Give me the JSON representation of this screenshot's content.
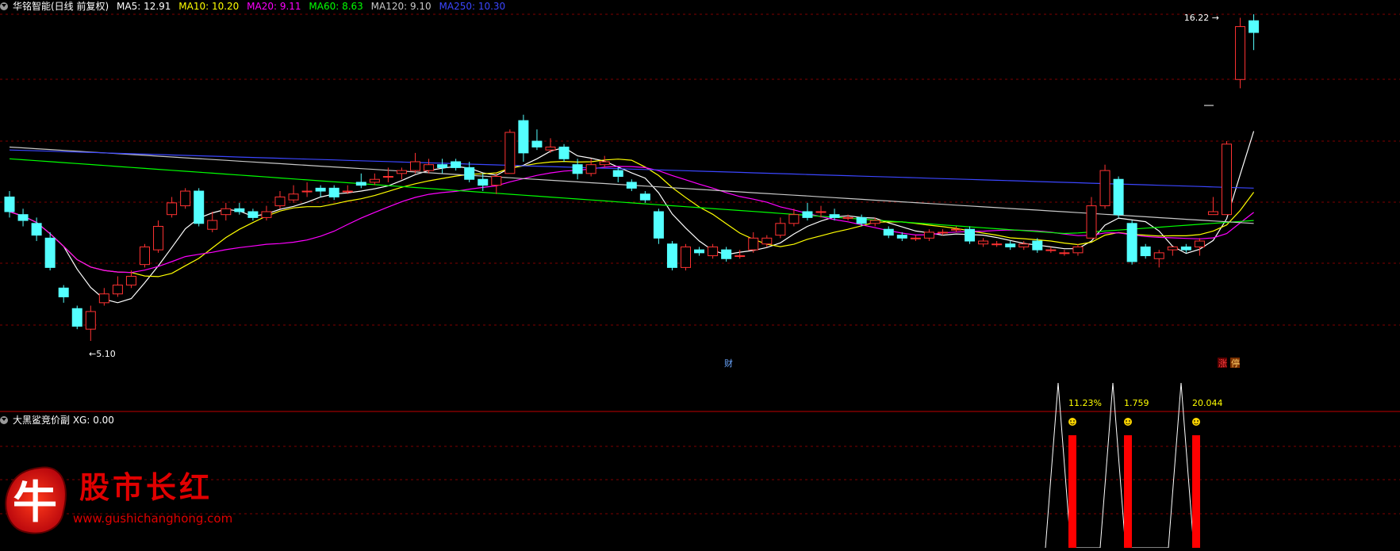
{
  "header": {
    "stock_title": "华铭智能(日线 前复权)",
    "ma": [
      {
        "label": "MA5: 12.91",
        "color": "#ffffff"
      },
      {
        "label": "MA10: 10.20",
        "color": "#ffff00"
      },
      {
        "label": "MA20: 9.11",
        "color": "#ff00ff"
      },
      {
        "label": "MA60: 8.63",
        "color": "#00ff00"
      },
      {
        "label": "MA120: 9.10",
        "color": "#c8c8c8"
      },
      {
        "label": "MA250: 10.30",
        "color": "#3b46ff"
      }
    ]
  },
  "price_panel": {
    "high_label": "16.22",
    "low_label": "5.10",
    "markers": {
      "cai": "财",
      "zhang": "涨",
      "ting": "停"
    }
  },
  "indicator_panel": {
    "title": "大黑鲨竞价副 XG: 0.00",
    "signals": [
      {
        "label": "11.23%",
        "percent_sign": "%"
      },
      {
        "label": "1.759",
        "percent_sign": "%"
      },
      {
        "label": "20.044",
        "percent_sign": "%"
      }
    ]
  },
  "watermark": {
    "char": "牛",
    "name": "股市长红",
    "url": "www.gushichanghong.com"
  },
  "colors": {
    "up": "#ff3232",
    "down": "#54ffff",
    "ma5": "#ffffff",
    "ma10": "#ffff00",
    "ma20": "#ff00ff",
    "ma60": "#00ff00",
    "ma120": "#c8c8c8",
    "ma250": "#3b46ff",
    "grid": "#800000"
  },
  "chart_data": {
    "type": "candlestick",
    "title": "华铭智能(日线 前复权)",
    "price_range": [
      5.1,
      16.22
    ],
    "annotations": {
      "max": 16.22,
      "min": 5.1
    },
    "candles": [
      [
        10.0,
        9.5,
        10.2,
        9.3
      ],
      [
        9.4,
        9.2,
        9.6,
        9.0
      ],
      [
        9.1,
        8.7,
        9.3,
        8.5
      ],
      [
        8.6,
        7.6,
        8.8,
        7.5
      ],
      [
        6.9,
        6.6,
        7.0,
        6.4
      ],
      [
        6.2,
        5.6,
        6.3,
        5.5
      ],
      [
        5.5,
        6.1,
        6.3,
        5.1
      ],
      [
        6.4,
        6.7,
        6.9,
        6.3
      ],
      [
        6.7,
        7.0,
        7.3,
        6.6
      ],
      [
        7.0,
        7.3,
        7.5,
        6.9
      ],
      [
        7.7,
        8.3,
        8.4,
        7.6
      ],
      [
        8.2,
        9.0,
        9.2,
        8.1
      ],
      [
        9.4,
        9.8,
        10.0,
        9.3
      ],
      [
        9.7,
        10.2,
        10.3,
        9.6
      ],
      [
        10.2,
        9.1,
        10.3,
        9.0
      ],
      [
        8.9,
        9.2,
        9.5,
        8.8
      ],
      [
        9.4,
        9.6,
        9.8,
        9.2
      ],
      [
        9.6,
        9.5,
        9.8,
        9.4
      ],
      [
        9.5,
        9.3,
        9.6,
        9.2
      ],
      [
        9.3,
        9.5,
        9.7,
        9.2
      ],
      [
        9.7,
        10.0,
        10.2,
        9.6
      ],
      [
        9.9,
        10.1,
        10.4,
        9.8
      ],
      [
        10.2,
        10.2,
        10.5,
        10.0
      ],
      [
        10.3,
        10.2,
        10.4,
        10.0
      ],
      [
        10.3,
        10.0,
        10.4,
        9.9
      ],
      [
        10.2,
        10.2,
        10.4,
        10.1
      ],
      [
        10.5,
        10.4,
        10.8,
        10.3
      ],
      [
        10.5,
        10.6,
        10.8,
        10.4
      ],
      [
        10.7,
        10.7,
        11.0,
        10.5
      ],
      [
        10.8,
        10.9,
        11.0,
        10.6
      ],
      [
        10.9,
        11.2,
        11.5,
        10.8
      ],
      [
        10.9,
        11.1,
        11.3,
        10.8
      ],
      [
        11.1,
        11.0,
        11.3,
        10.8
      ],
      [
        11.2,
        11.0,
        11.3,
        10.9
      ],
      [
        11.0,
        10.6,
        11.2,
        10.5
      ],
      [
        10.6,
        10.4,
        10.8,
        10.2
      ],
      [
        10.4,
        10.7,
        10.8,
        10.1
      ],
      [
        10.8,
        12.2,
        12.3,
        10.8
      ],
      [
        12.6,
        11.5,
        12.8,
        11.2
      ],
      [
        11.9,
        11.7,
        12.3,
        11.6
      ],
      [
        11.6,
        11.7,
        12.0,
        11.5
      ],
      [
        11.7,
        11.3,
        11.8,
        11.2
      ],
      [
        11.1,
        10.8,
        11.3,
        10.6
      ],
      [
        10.8,
        11.1,
        11.3,
        10.7
      ],
      [
        11.1,
        11.2,
        11.4,
        11.0
      ],
      [
        10.9,
        10.7,
        11.0,
        10.5
      ],
      [
        10.5,
        10.3,
        10.6,
        10.2
      ],
      [
        10.1,
        9.9,
        10.2,
        9.8
      ],
      [
        9.5,
        8.6,
        9.6,
        8.4
      ],
      [
        8.4,
        7.6,
        8.5,
        7.5
      ],
      [
        7.6,
        8.3,
        8.4,
        7.5
      ],
      [
        8.2,
        8.1,
        8.3,
        8.0
      ],
      [
        8.0,
        8.3,
        8.4,
        7.9
      ],
      [
        8.2,
        7.9,
        8.3,
        7.8
      ],
      [
        8.0,
        8.0,
        8.2,
        7.9
      ],
      [
        8.2,
        8.6,
        8.8,
        8.1
      ],
      [
        8.4,
        8.6,
        8.7,
        8.3
      ],
      [
        8.7,
        9.1,
        9.3,
        8.6
      ],
      [
        9.1,
        9.4,
        9.6,
        9.0
      ],
      [
        9.5,
        9.3,
        9.8,
        9.2
      ],
      [
        9.5,
        9.5,
        9.7,
        9.3
      ],
      [
        9.4,
        9.3,
        9.6,
        9.2
      ],
      [
        9.3,
        9.3,
        9.4,
        9.2
      ],
      [
        9.3,
        9.1,
        9.4,
        9.0
      ],
      [
        9.1,
        9.2,
        9.3,
        9.0
      ],
      [
        8.9,
        8.7,
        9.0,
        8.6
      ],
      [
        8.7,
        8.6,
        8.8,
        8.5
      ],
      [
        8.6,
        8.6,
        8.7,
        8.5
      ],
      [
        8.6,
        8.8,
        8.9,
        8.5
      ],
      [
        8.8,
        8.8,
        8.9,
        8.7
      ],
      [
        8.9,
        8.9,
        9.0,
        8.8
      ],
      [
        8.9,
        8.5,
        9.0,
        8.4
      ],
      [
        8.4,
        8.5,
        8.6,
        8.3
      ],
      [
        8.4,
        8.4,
        8.5,
        8.3
      ],
      [
        8.4,
        8.3,
        8.5,
        8.2
      ],
      [
        8.3,
        8.4,
        8.5,
        8.2
      ],
      [
        8.5,
        8.2,
        8.6,
        8.1
      ],
      [
        8.2,
        8.2,
        8.3,
        8.1
      ],
      [
        8.1,
        8.1,
        8.2,
        8.0
      ],
      [
        8.1,
        8.3,
        8.4,
        8.0
      ],
      [
        8.6,
        9.7,
        10.0,
        8.6
      ],
      [
        9.7,
        10.9,
        11.1,
        9.6
      ],
      [
        10.6,
        9.4,
        10.7,
        9.3
      ],
      [
        9.1,
        7.8,
        9.2,
        7.7
      ],
      [
        8.3,
        8.0,
        8.4,
        7.9
      ],
      [
        7.9,
        8.1,
        8.2,
        7.6
      ],
      [
        8.2,
        8.3,
        8.3,
        8.0
      ],
      [
        8.3,
        8.2,
        8.4,
        8.1
      ],
      [
        8.3,
        8.5,
        8.6,
        8.0
      ],
      [
        9.4,
        9.5,
        10.0,
        9.4
      ],
      [
        9.4,
        11.8,
        11.9,
        9.4
      ],
      [
        14.0,
        15.8,
        16.1,
        13.7
      ],
      [
        16.0,
        15.6,
        16.22,
        15.0
      ]
    ]
  }
}
